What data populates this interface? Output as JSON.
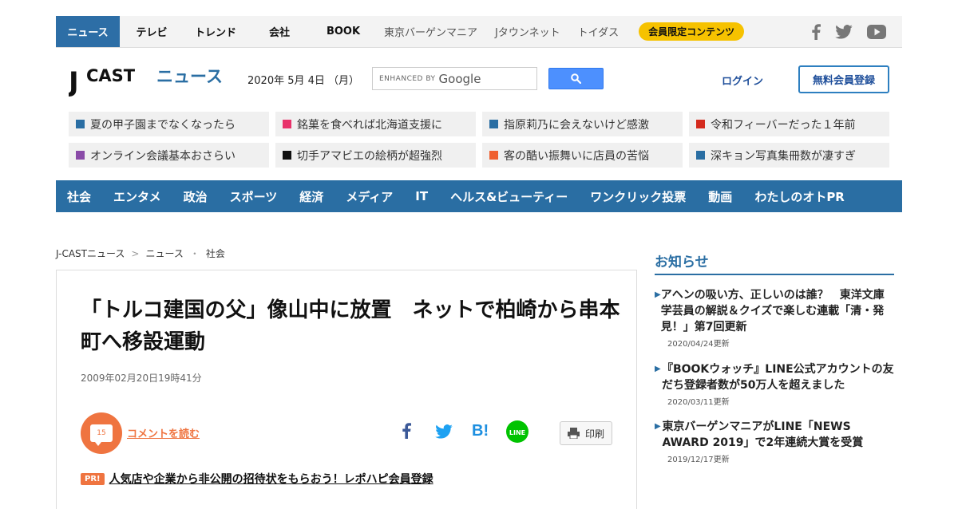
{
  "colors": {
    "brand_blue": "#2a6ea3",
    "accent_orange": "#ef7440",
    "pill_yellow": "#f6c200"
  },
  "topnav": {
    "items": [
      "ニュース",
      "テレビ",
      "トレンド",
      "会社",
      "BOOK",
      "東京バーゲンマニア",
      "Jタウンネット",
      "トイダス"
    ],
    "member_pill": "会員限定コンテンツ"
  },
  "header": {
    "logo_j": "J",
    "logo_cast": "CAST",
    "logo_news": "ニュース",
    "date": "2020年 5月 4日 （月）",
    "search_enhanced": "ENHANCED BY",
    "search_google": "Google",
    "login": "ログイン",
    "register": "無料会員登録"
  },
  "tags": [
    {
      "label": "夏の甲子園までなくなったら",
      "color": "#2a6ea3"
    },
    {
      "label": "銘菓を食べれば北海道支援に",
      "color": "#e8336b"
    },
    {
      "label": "指原莉乃に会えないけど感激",
      "color": "#2a6ea3"
    },
    {
      "label": "令和フィーバーだった１年前",
      "color": "#d42b1e"
    },
    {
      "label": "オンライン会議基本おさらい",
      "color": "#8a4ba8"
    },
    {
      "label": "切手アマビエの絵柄が超強烈",
      "color": "#111111"
    },
    {
      "label": "客の酷い振舞いに店員の苦悩",
      "color": "#ef6030"
    },
    {
      "label": "深キョン写真集冊数が凄すぎ",
      "color": "#2a6ea3"
    }
  ],
  "categories": [
    "社会",
    "エンタメ",
    "政治",
    "スポーツ",
    "経済",
    "メディア",
    "IT",
    "ヘルス&ビューティー",
    "ワンクリック投票",
    "動画",
    "わたしのオトPR"
  ],
  "breadcrumb": {
    "home": "J-CASTニュース",
    "sep1": ">",
    "section": "ニュース",
    "sep2": "・",
    "category": "社会"
  },
  "article": {
    "headline": "「トルコ建国の父」像山中に放置　ネットで柏崎から串本町へ移設運動",
    "timestamp": "2009年02月20日19時41分",
    "comment_count": "15",
    "comment_link": "コメントを読む",
    "hatena_label": "B!",
    "line_label": "LINE",
    "print_label": "印刷",
    "pr_badge": "PR!",
    "pr_text": "人気店や企業から非公開の招待状をもらおう！レポハピ会員登録"
  },
  "sidebar": {
    "title": "お知らせ",
    "arrow": "▶",
    "items": [
      {
        "title": "アヘンの吸い方、正しいのは誰？　東洋文庫学芸員の解説＆クイズで楽しむ連載「清・発見！」第7回更新",
        "date": "2020/04/24更新"
      },
      {
        "title": "『BOOKウォッチ』LINE公式アカウントの友だち登録者数が50万人を超えました",
        "date": "2020/03/11更新"
      },
      {
        "title": "東京バーゲンマニアがLINE「NEWS AWARD 2019」で2年連続大賞を受賞",
        "date": "2019/12/17更新"
      }
    ]
  }
}
